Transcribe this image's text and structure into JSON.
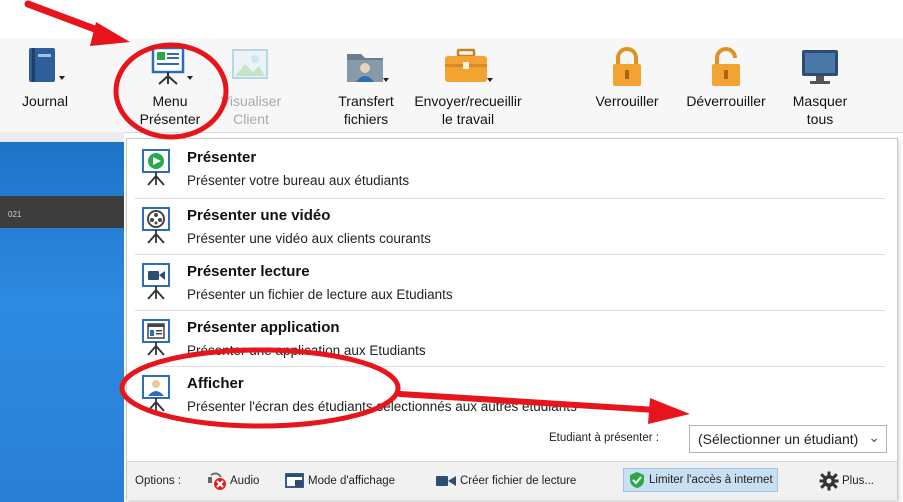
{
  "toolbar": {
    "items": [
      {
        "label": "Journal",
        "icon": "journal-icon"
      },
      {
        "label": "Menu\nPrésenter",
        "icon": "presenter-menu-icon"
      },
      {
        "label": "Visualiser\nClient",
        "icon": "view-client-icon",
        "disabled": true
      },
      {
        "label": "Transfert\nfichiers",
        "icon": "file-transfer-icon"
      },
      {
        "label": "Envoyer/recueillir\nle travail",
        "icon": "briefcase-icon"
      },
      {
        "label": "Verrouiller",
        "icon": "lock-icon"
      },
      {
        "label": "Déverrouiller",
        "icon": "unlock-icon"
      },
      {
        "label": "Masquer\ntous",
        "icon": "monitor-icon"
      }
    ]
  },
  "background": {
    "strip_text": "021"
  },
  "menu": {
    "items": [
      {
        "title": "Présenter",
        "desc": "Présenter votre bureau aux étudiants",
        "icon": "present-play-icon"
      },
      {
        "title": "Présenter une vidéo",
        "desc": "Présenter une vidéo aux clients courants",
        "icon": "present-video-icon"
      },
      {
        "title": "Présenter lecture",
        "desc": "Présenter un fichier de lecture aux Etudiants",
        "icon": "present-replay-icon"
      },
      {
        "title": "Présenter application",
        "desc": "Présenter une application aux Etudiants",
        "icon": "present-application-icon"
      },
      {
        "title": "Afficher",
        "desc": "Présenter l'écran des étudiants sélectionnés aux autres étudiants",
        "icon": "show-student-icon"
      }
    ],
    "student_label": "Etudiant à présenter :",
    "student_select": "(Sélectionner un étudiant)"
  },
  "options": {
    "label": "Options :",
    "audio": "Audio",
    "display_mode": "Mode d'affichage",
    "create_replay": "Créer fichier de lecture",
    "limit_internet": "Limiter l'accès à internet",
    "more": "Plus..."
  },
  "colors": {
    "annotation_red": "#e8141b",
    "accent_blue": "#2d6db5",
    "lock_orange": "#f2a332",
    "present_green": "#2aa84a"
  }
}
